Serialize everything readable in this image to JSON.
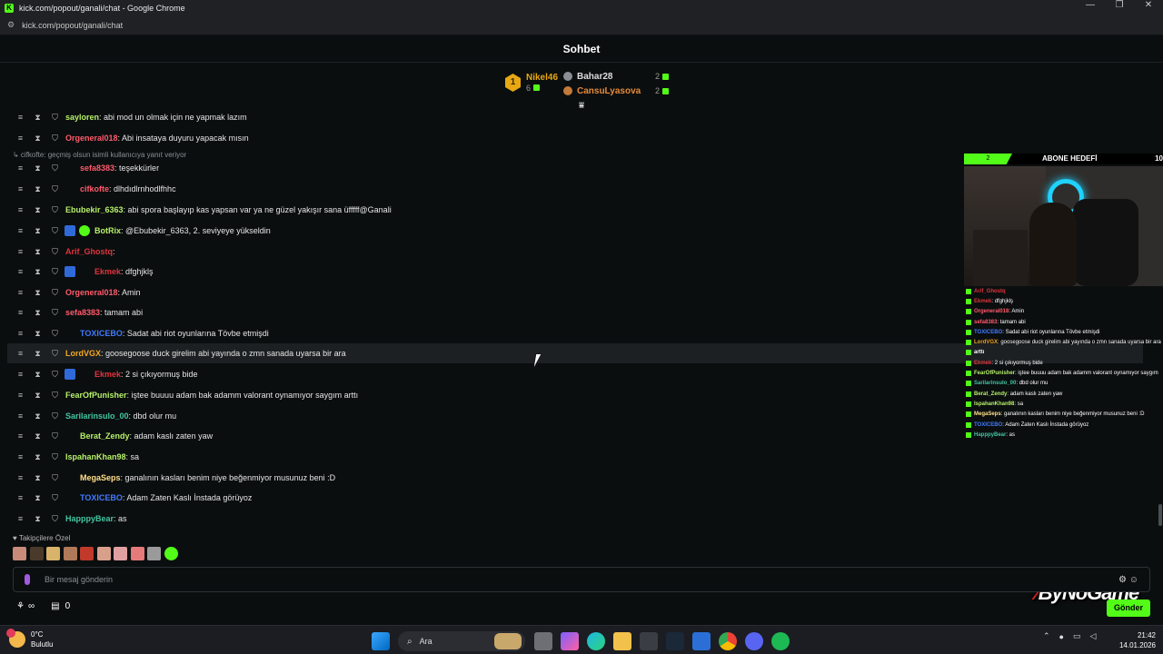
{
  "window": {
    "title": "kick.com/popout/ganali/chat - Google Chrome",
    "url": "kick.com/popout/ganali/chat",
    "controls": [
      "—",
      "❐",
      "✕"
    ]
  },
  "chat": {
    "header": "Sohbet",
    "leaderboard": {
      "first": {
        "rank": "1",
        "name": "Nikel46",
        "count": "6"
      },
      "others": [
        {
          "name": "Bahar28",
          "count": "2"
        },
        {
          "name": "CansuLyasova",
          "count": "2"
        }
      ]
    },
    "reply_note": "↳ cifkofte: geçmiş olsun isimli kullanıcıya yanıt veriyor",
    "messages": [
      {
        "user": "sayloren",
        "color": "#b6f06a",
        "text": ": abi mod un olmak için ne yapmak lazım",
        "badges": []
      },
      {
        "user": "Orgeneral018",
        "color": "#ff5a6b",
        "text": ": Abi insataya duyuru yapacak mısın",
        "badges": []
      },
      {
        "user": "sefa8383",
        "color": "#ff5a6b",
        "text": ": teşekkürler",
        "badges": [
          "sub-red"
        ]
      },
      {
        "user": "cifkofte",
        "color": "#ff5a6b",
        "text": ": dlhdıdlrnhodlfhhc",
        "badges": [
          "sub-red"
        ]
      },
      {
        "user": "Ebubekir_6363",
        "color": "#b6f06a",
        "text": ": abi spora başlayıp kas yapsan var ya ne güzel yakışır sana üfffff@Ganali",
        "badges": []
      },
      {
        "user": "BotRix",
        "color": "#b6f06a",
        "text": ": @Ebubekir_6363, 2. seviyeye yükseldin",
        "badges": [
          "bot",
          "verified"
        ]
      },
      {
        "user": "Arif_Ghostq",
        "color": "#e0343c",
        "text": ": ",
        "badges": []
      },
      {
        "user": "Ekmek",
        "color": "#e0343c",
        "text": ": dfghjklş",
        "badges": [
          "bot",
          "sub-red"
        ]
      },
      {
        "user": "Orgeneral018",
        "color": "#ff5a6b",
        "text": ": Amin",
        "badges": []
      },
      {
        "user": "sefa8383",
        "color": "#ff5a6b",
        "text": ": tamam abi",
        "badges": []
      },
      {
        "user": "TOXICEBO",
        "color": "#3f7bff",
        "text": ": Sadat abi riot oyunlarına Tövbe etmişdi",
        "badges": [
          "sub-red"
        ]
      },
      {
        "user": "LordVGX",
        "color": "#f5a623",
        "text": ": goosegoose duck girelim abi yayında o zmn sanada uyarsa bir ara",
        "badges": []
      },
      {
        "user": "Ekmek",
        "color": "#e0343c",
        "text": ": 2 si çıkıyormuş bide",
        "badges": [
          "bot",
          "sub-red"
        ]
      },
      {
        "user": "FearOfPunisher",
        "color": "#b6f06a",
        "text": ": işteе buuuu adam bak adamm valorant oynamıyor saygım arttı",
        "badges": []
      },
      {
        "user": "Sarilarinsulo_00",
        "color": "#42c6a0",
        "text": ": dbd olur mu",
        "badges": []
      },
      {
        "user": "Berat_Zendy",
        "color": "#b6f06a",
        "text": ": adam kaslı zaten yaw",
        "badges": [
          "sub-green"
        ]
      },
      {
        "user": "IspahanKhan98",
        "color": "#b6f06a",
        "text": ": sa",
        "badges": []
      },
      {
        "user": "MegaSeps",
        "color": "#ffe08a",
        "text": ": ganalının kasları benim niye beğenmiyor musunuz beni :D",
        "badges": [
          "sub-red"
        ]
      },
      {
        "user": "TOXICEBO",
        "color": "#3f7bff",
        "text": ": Adam Zaten Kaslı İnstada görüyoz",
        "badges": [
          "sub-red"
        ]
      },
      {
        "user": "HapppyBear",
        "color": "#42c6a0",
        "text": ": as",
        "badges": []
      }
    ],
    "followers_label": "♥ Takipçilere Özel",
    "input_placeholder": "Bir mesaj gönderin",
    "bottom_count": "0",
    "send_label": "Gönder"
  },
  "overlay": {
    "goal_label": "ABONE HEDEFİ",
    "goal_current": "2",
    "goal_target": "10",
    "lines": [
      {
        "user": "Arif_Ghostq",
        "color": "#e0343c",
        "text": ""
      },
      {
        "user": "Ekmek",
        "color": "#e0343c",
        "text": ": dfghjklş"
      },
      {
        "user": "Orgeneral018",
        "color": "#ff5a6b",
        "text": ": Amin"
      },
      {
        "user": "sefa8383",
        "color": "#ff5a6b",
        "text": ": tamam abi"
      },
      {
        "user": "TOXICEBO",
        "color": "#3f7bff",
        "text": ": Sadat abi riot oyunlarına Tövbe etmişdi"
      },
      {
        "user": "LordVGX",
        "color": "#f5a623",
        "text": ": goosegoose duck girelim abi yayında o zmn sanada uyarsa bir ara"
      },
      {
        "user": "arttı",
        "color": "#ffffff",
        "text": ""
      },
      {
        "user": "Ekmek",
        "color": "#e0343c",
        "text": ": 2 si çıkıyormuş bide"
      },
      {
        "user": "FearOfPunisher",
        "color": "#b6f06a",
        "text": ": işteе buuuu adam bak adamm valorant oynamıyor saygım"
      },
      {
        "user": "Sarilarinsulo_00",
        "color": "#42c6a0",
        "text": ": dbd olur mu"
      },
      {
        "user": "Berat_Zendy",
        "color": "#b6f06a",
        "text": ": adam kaslı zaten yaw"
      },
      {
        "user": "IspahanKhan98",
        "color": "#b6f06a",
        "text": ": sa"
      },
      {
        "user": "MegaSeps",
        "color": "#ffe08a",
        "text": ": ganalının kasları benim niye beğenmiyor musunuz beni :D"
      },
      {
        "user": "TOXICEBO",
        "color": "#3f7bff",
        "text": ": Adam Zaten Kaslı İnstada görüyoz"
      },
      {
        "user": "HapppyBear",
        "color": "#42c6a0",
        "text": ": as"
      }
    ],
    "brand": {
      "a": "By",
      "b": "NoGame"
    }
  },
  "taskbar": {
    "weather_temp": "0°C",
    "weather_desc": "Bulutlu",
    "search_label": "Ara",
    "time": "21:42",
    "date": "14.01.2026"
  },
  "colors": {
    "accent": "#53fc18",
    "bg": "#0b0e0f"
  }
}
